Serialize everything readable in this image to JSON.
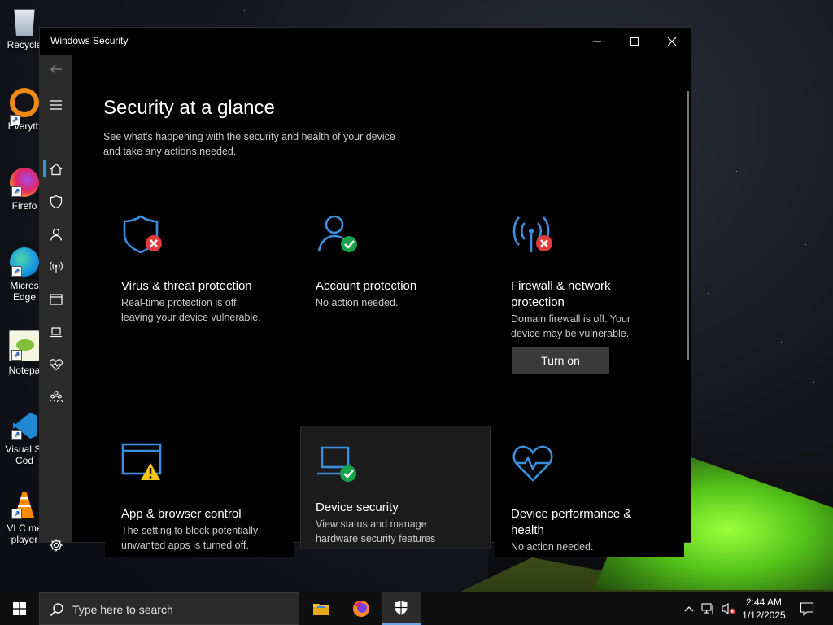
{
  "desktop": {
    "icons": [
      {
        "label": "Recycle",
        "icon": "recycle-bin-icon"
      },
      {
        "label": "Everyth",
        "icon": "everything-search-icon"
      },
      {
        "label": "Firefo",
        "icon": "firefox-icon"
      },
      {
        "label": "Micros Edge",
        "icon": "edge-icon"
      },
      {
        "label": "Notepa",
        "icon": "notepad-icon"
      },
      {
        "label": "Visual St Cod",
        "icon": "vscode-icon"
      },
      {
        "label": "VLC me player",
        "icon": "vlc-icon"
      }
    ]
  },
  "window": {
    "title": "Windows Security",
    "controls": {
      "minimize": "—",
      "maximize": "☐",
      "close": "✕"
    }
  },
  "sidebar": {
    "items": [
      {
        "name": "back",
        "icon": "back-arrow-icon"
      },
      {
        "name": "menu",
        "icon": "hamburger-menu-icon"
      },
      {
        "name": "home",
        "icon": "home-icon"
      },
      {
        "name": "virus",
        "icon": "shield-icon"
      },
      {
        "name": "account",
        "icon": "person-icon"
      },
      {
        "name": "firewall",
        "icon": "antenna-icon"
      },
      {
        "name": "app-browser",
        "icon": "browser-window-icon"
      },
      {
        "name": "device-security",
        "icon": "laptop-icon"
      },
      {
        "name": "device-performance",
        "icon": "heart-pulse-icon"
      },
      {
        "name": "family",
        "icon": "family-icon"
      },
      {
        "name": "settings",
        "icon": "gear-icon"
      }
    ]
  },
  "main": {
    "title": "Security at a glance",
    "subtitle_line1": "See what's happening with the security and health of your device",
    "subtitle_line2": "and take any actions needed.",
    "cards": [
      {
        "title": "Virus & threat protection",
        "desc1": "Real-time protection is off,",
        "desc2": "leaving your device vulnerable.",
        "status": "error"
      },
      {
        "title": "Account protection",
        "desc1": "No action needed.",
        "desc2": "",
        "status": "ok"
      },
      {
        "title1": "Firewall & network",
        "title2": "protection",
        "desc1": "Domain firewall is off. Your",
        "desc2": "device may be vulnerable.",
        "status": "error",
        "button": "Turn on"
      },
      {
        "title": "App & browser control",
        "desc1": "The setting to block potentially",
        "desc2": "unwanted apps is turned off.",
        "status": "warning"
      },
      {
        "title": "Device security",
        "desc1": "View status and manage",
        "desc2": "hardware security features",
        "status": "ok"
      },
      {
        "title1": "Device performance &",
        "title2": "health",
        "desc1": "No action needed.",
        "desc2": "",
        "status": "ok"
      }
    ]
  },
  "colors": {
    "accent": "#3a8fdf",
    "ok": "#16a34a",
    "error": "#e23b3b",
    "warning": "#f6c415"
  },
  "taskbar": {
    "search_placeholder": "Type here to search",
    "time": "2:44 AM",
    "date": "1/12/2025"
  }
}
